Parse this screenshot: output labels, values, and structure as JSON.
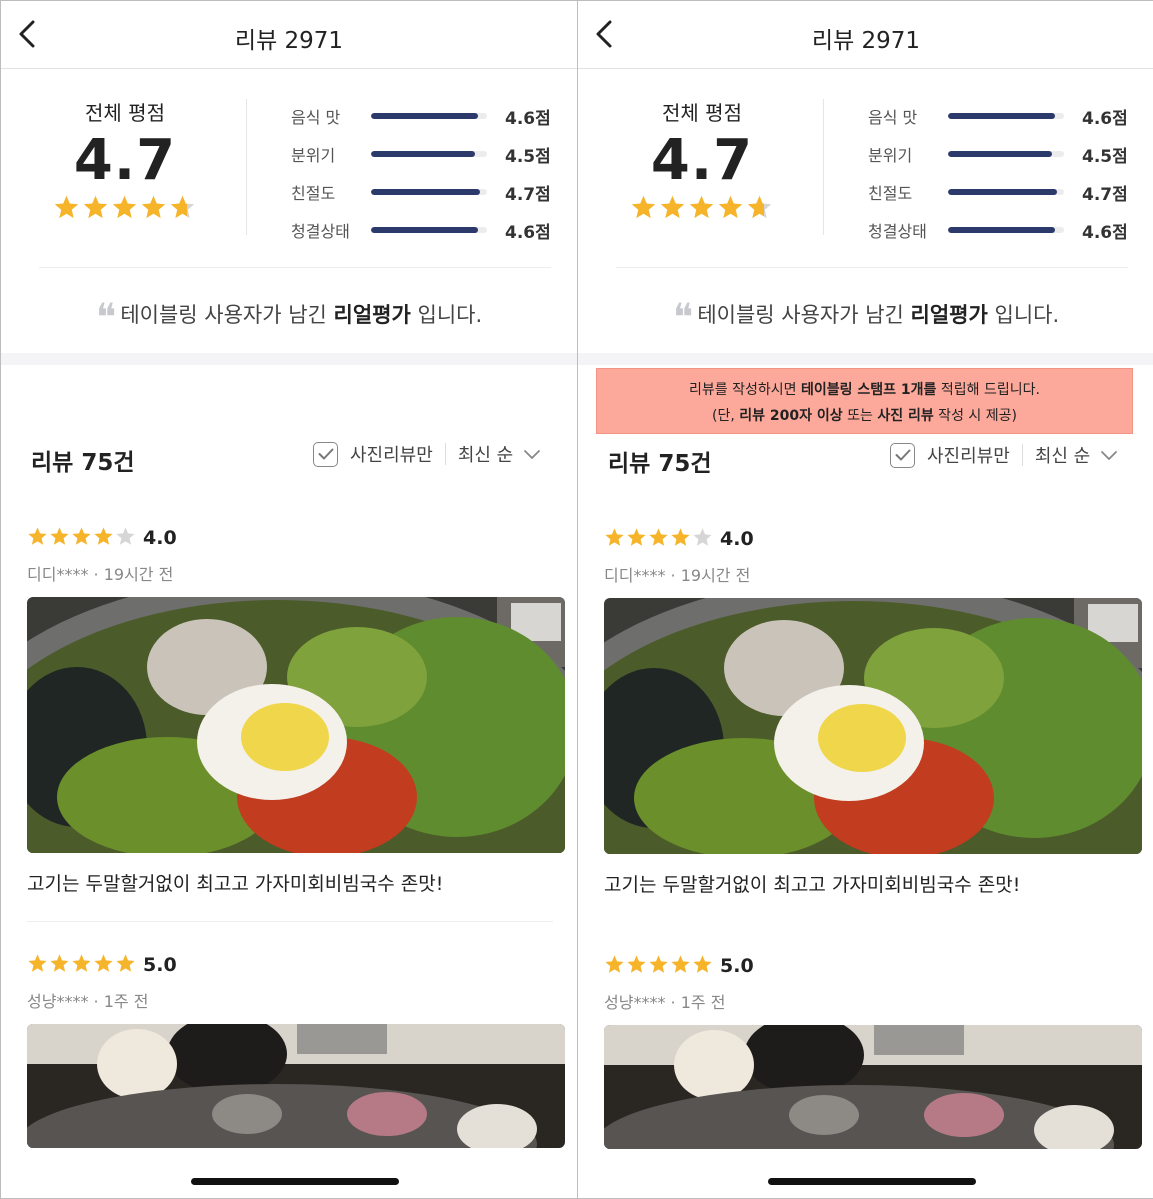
{
  "screens": [
    {
      "header": {
        "title": "리뷰 2971"
      },
      "summary": {
        "overall_label": "전체 평점",
        "overall_score": "4.7",
        "overall_stars": 4.7,
        "criteria": [
          {
            "label": "음식 맛",
            "value": "4.6점",
            "level": 0.92
          },
          {
            "label": "분위기",
            "value": "4.5점",
            "level": 0.9
          },
          {
            "label": "친절도",
            "value": "4.7점",
            "level": 0.94
          },
          {
            "label": "청결상태",
            "value": "4.6점",
            "level": 0.92
          }
        ],
        "notice_pre": "테이블링 사용자가 남긴 ",
        "notice_bold": "리얼평가",
        "notice_post": " 입니다."
      },
      "reviews_header": {
        "title": "리뷰 75건",
        "photo_only_label": "사진리뷰만",
        "sort_label": "최신 순"
      },
      "reviews": [
        {
          "rating": "4.0",
          "stars": 4,
          "author": "디디****",
          "time": "19시간 전",
          "text": "고기는 두말할거없이 최고고 가자미회비빔국수 존맛!"
        },
        {
          "rating": "5.0",
          "stars": 5,
          "author": "성냥****",
          "time": "1주 전",
          "text": ""
        }
      ]
    },
    {
      "header": {
        "title": "리뷰 2971"
      },
      "summary": {
        "overall_label": "전체 평점",
        "overall_score": "4.7",
        "overall_stars": 4.7,
        "criteria": [
          {
            "label": "음식 맛",
            "value": "4.6점",
            "level": 0.92
          },
          {
            "label": "분위기",
            "value": "4.5점",
            "level": 0.9
          },
          {
            "label": "친절도",
            "value": "4.7점",
            "level": 0.94
          },
          {
            "label": "청결상태",
            "value": "4.6점",
            "level": 0.92
          }
        ],
        "notice_pre": "테이블링 사용자가 남긴 ",
        "notice_bold": "리얼평가",
        "notice_post": " 입니다."
      },
      "banner": {
        "l1_pre": "리뷰를 작성하시면 ",
        "l1_bold": "테이블링 스탬프 1개를",
        "l1_post": " 적립해 드립니다.",
        "l2_pre": "(단, ",
        "l2_bold1": "리뷰 200자 이상",
        "l2_mid": " 또는 ",
        "l2_bold2": "사진 리뷰",
        "l2_post": " 작성 시 제공)"
      },
      "reviews_header": {
        "title": "리뷰 75건",
        "photo_only_label": "사진리뷰만",
        "sort_label": "최신 순"
      },
      "reviews": [
        {
          "rating": "4.0",
          "stars": 4,
          "author": "디디****",
          "time": "19시간 전",
          "text": "고기는 두말할거없이 최고고 가자미회비빔국수 존맛!"
        },
        {
          "rating": "5.0",
          "stars": 5,
          "author": "성냥****",
          "time": "1주 전",
          "text": ""
        }
      ]
    }
  ],
  "colors": {
    "star": "#f5b42a",
    "star_empty": "#d6d6d6",
    "bar_fill": "#2b3a6b",
    "banner_bg": "#fca89a"
  }
}
